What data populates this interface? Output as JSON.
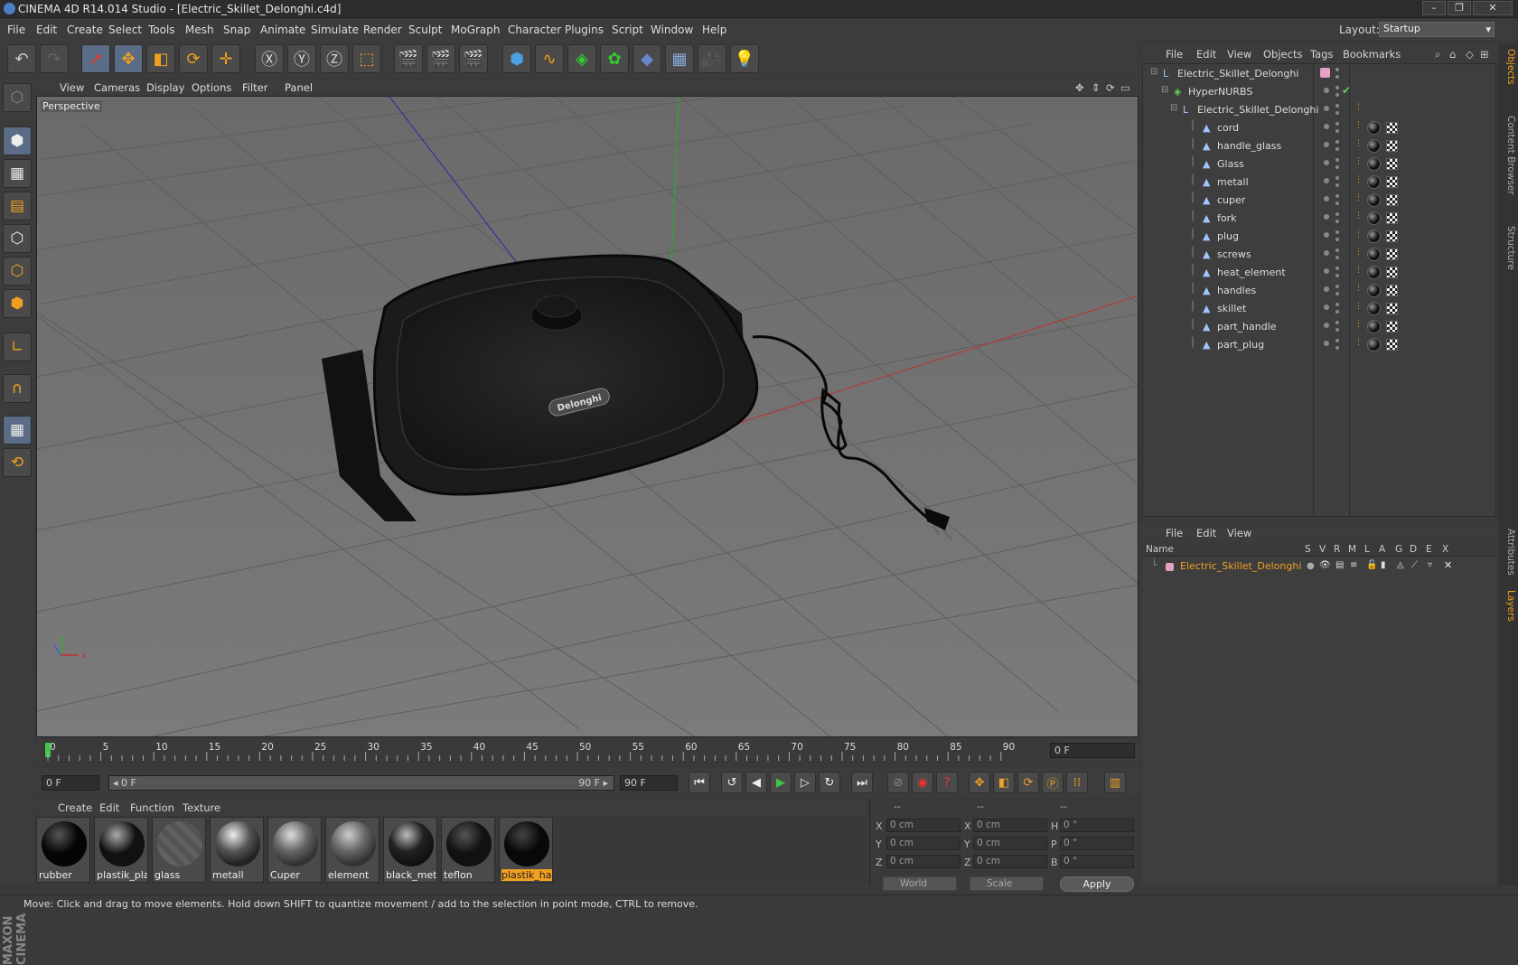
{
  "window": {
    "title": "CINEMA 4D R14.014 Studio - [Electric_Skillet_Delonghi.c4d]",
    "minimize": "–",
    "maximize": "❐",
    "close": "✕"
  },
  "menubar": {
    "items": [
      "File",
      "Edit",
      "Create",
      "Select",
      "Tools",
      "Mesh",
      "Snap",
      "Animate",
      "Simulate",
      "Render",
      "Sculpt",
      "MoGraph",
      "Character",
      "Plugins",
      "Script",
      "Window",
      "Help"
    ],
    "layout_label": "Layout:",
    "layout_value": "Startup"
  },
  "viewport": {
    "menu": [
      "View",
      "Cameras",
      "Display",
      "Options",
      "Filter",
      "Panel"
    ],
    "label": "Perspective",
    "brand_text": "Delonghi"
  },
  "timeline": {
    "ticks": [
      "0",
      "5",
      "10",
      "15",
      "20",
      "25",
      "30",
      "35",
      "40",
      "45",
      "50",
      "55",
      "60",
      "65",
      "70",
      "75",
      "80",
      "85",
      "90"
    ],
    "end_field": "0 F"
  },
  "transport": {
    "current_frame": "0 F",
    "range_start": "◂ 0 F",
    "range_end": "90 F ▸",
    "max_frame": "90 F"
  },
  "materials": {
    "menu": [
      "Create",
      "Edit",
      "Function",
      "Texture"
    ],
    "items": [
      "rubber",
      "plastik_pla",
      "glass",
      "metall",
      "Cuper",
      "element",
      "black_meta",
      "teflon",
      "plastik_har"
    ],
    "selected": "plastik_har"
  },
  "coordinates": {
    "headers": [
      "--",
      "--",
      "--"
    ],
    "rows": [
      {
        "a": "X",
        "av": "0 cm",
        "b": "X",
        "bv": "0 cm",
        "c": "H",
        "cv": "0 °"
      },
      {
        "a": "Y",
        "av": "0 cm",
        "b": "Y",
        "bv": "0 cm",
        "c": "P",
        "cv": "0 °"
      },
      {
        "a": "Z",
        "av": "0 cm",
        "b": "Z",
        "bv": "0 cm",
        "c": "B",
        "cv": "0 °"
      }
    ],
    "mode1": "World",
    "mode2": "Scale",
    "apply": "Apply"
  },
  "objects": {
    "menu": [
      "File",
      "Edit",
      "View",
      "Objects",
      "Tags",
      "Bookmarks"
    ],
    "tree": [
      {
        "name": "Electric_Skillet_Delonghi",
        "level": 0
      },
      {
        "name": "HyperNURBS",
        "level": 1
      },
      {
        "name": "Electric_Skillet_Delonghi",
        "level": 2
      },
      {
        "name": "cord",
        "level": 3
      },
      {
        "name": "handle_glass",
        "level": 3
      },
      {
        "name": "Glass",
        "level": 3
      },
      {
        "name": "metall",
        "level": 3
      },
      {
        "name": "cuper",
        "level": 3
      },
      {
        "name": "fork",
        "level": 3
      },
      {
        "name": "plug",
        "level": 3
      },
      {
        "name": "screws",
        "level": 3
      },
      {
        "name": "heat_element",
        "level": 3
      },
      {
        "name": "handles",
        "level": 3
      },
      {
        "name": "skillet",
        "level": 3
      },
      {
        "name": "part_handle",
        "level": 3
      },
      {
        "name": "part_plug",
        "level": 3
      }
    ]
  },
  "layers": {
    "menu": [
      "File",
      "Edit",
      "View"
    ],
    "columns": [
      "Name",
      "S",
      "V",
      "R",
      "M",
      "L",
      "A",
      "G",
      "D",
      "E",
      "X"
    ],
    "rows": [
      "Electric_Skillet_Delonghi"
    ]
  },
  "side_tabs": [
    "Objects",
    "Content Browser",
    "Structure",
    "Attributes",
    "Layers"
  ],
  "status": "Move: Click and drag to move elements. Hold down SHIFT to quantize movement / add to the selection in point mode, CTRL to remove.",
  "brand": "MAXON CINEMA4D",
  "colors": {
    "accent": "#f0a020",
    "selection": "#5b6d86",
    "axis_x": "#c03030",
    "axis_y": "#30b030",
    "axis_z": "#3030c0"
  }
}
